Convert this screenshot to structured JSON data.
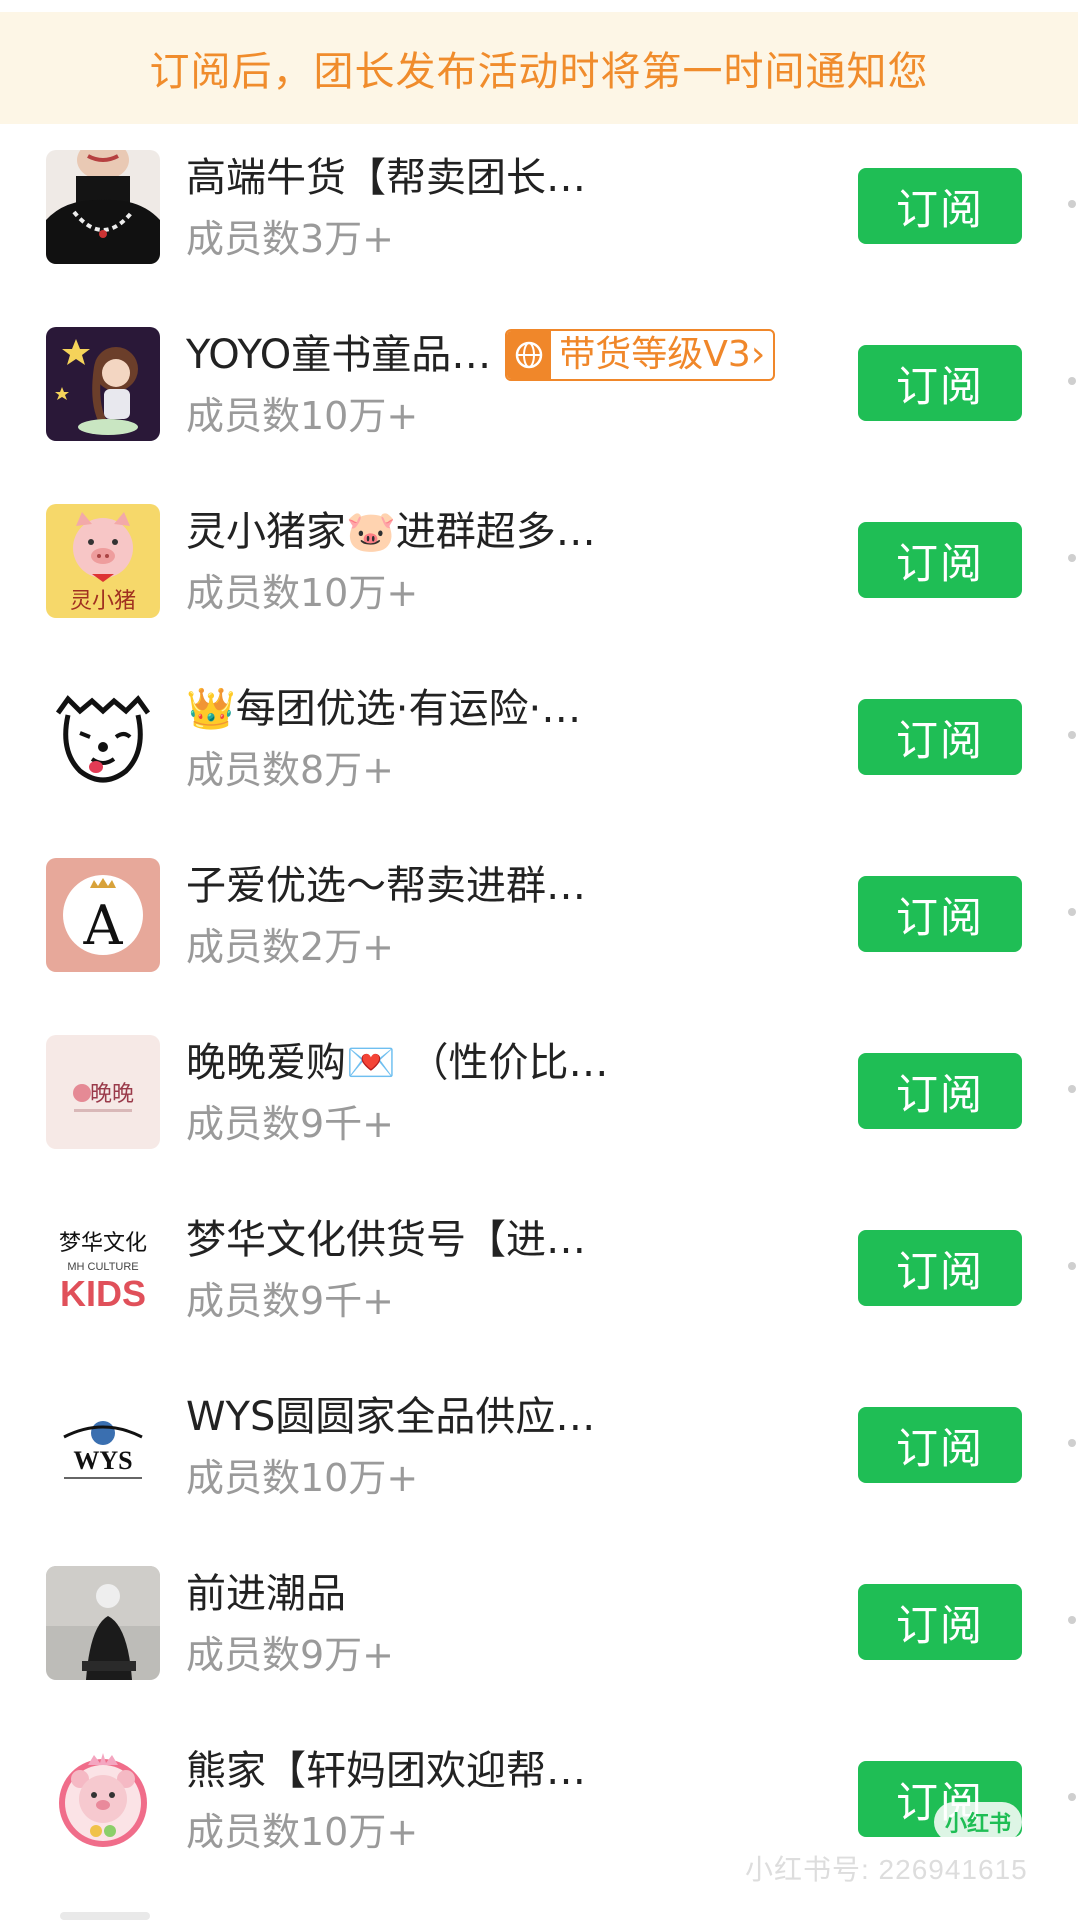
{
  "banner": {
    "text": "订阅后，团长发布活动时将第一时间通知您"
  },
  "list": {
    "items": [
      {
        "title": "高端牛货【帮卖团长…",
        "members": "成员数3万+",
        "button": "订阅",
        "avatar_icon": "woman-necklace-avatar"
      },
      {
        "title": "YOYO童书童品…",
        "members": "成员数10万+",
        "button": "订阅",
        "avatar_icon": "girl-stars-avatar",
        "badge": "带货等级V3",
        "badge_icon": "globe-icon",
        "badge_arrow": "›"
      },
      {
        "title": "灵小猪家🐷进群超多…",
        "members": "成员数10万+",
        "button": "订阅",
        "avatar_icon": "pig-avatar",
        "avatar_text": "灵小猪"
      },
      {
        "title": "👑每团优选·有运险·…",
        "members": "成员数8万+",
        "button": "订阅",
        "avatar_icon": "dog-face-avatar"
      },
      {
        "title": "子爱优选～帮卖进群…",
        "members": "成员数2万+",
        "button": "订阅",
        "avatar_icon": "letter-a-crown-avatar",
        "avatar_text": "A"
      },
      {
        "title": "晚晚爱购💌  （性价比…",
        "members": "成员数9千+",
        "button": "订阅",
        "avatar_icon": "wanwan-logo-avatar",
        "avatar_text": "晚晚"
      },
      {
        "title": "梦华文化供货号【进…",
        "members": "成员数9千+",
        "button": "订阅",
        "avatar_icon": "mh-culture-kids-avatar",
        "avatar_text": "梦华文化",
        "avatar_text2": "MH CULTURE",
        "avatar_text3": "KIDS"
      },
      {
        "title": "WYS圆圆家全品供应…",
        "members": "成员数10万+",
        "button": "订阅",
        "avatar_icon": "wys-logo-avatar",
        "avatar_text": "WYS"
      },
      {
        "title": "前进潮品",
        "members": "成员数9万+",
        "button": "订阅",
        "avatar_icon": "photo-person-avatar"
      },
      {
        "title": "熊家【轩妈团欢迎帮…",
        "members": "成员数10万+",
        "button": "订阅",
        "avatar_icon": "bear-avatar"
      }
    ]
  },
  "watermark": {
    "text": "小红书号: 226941615",
    "logo_text": "小红书"
  },
  "colors": {
    "banner_bg": "#fdf6e6",
    "banner_text": "#f08c2c",
    "button": "#1fbe55",
    "muted": "#9a9a9a",
    "badge": "#f0872a"
  }
}
